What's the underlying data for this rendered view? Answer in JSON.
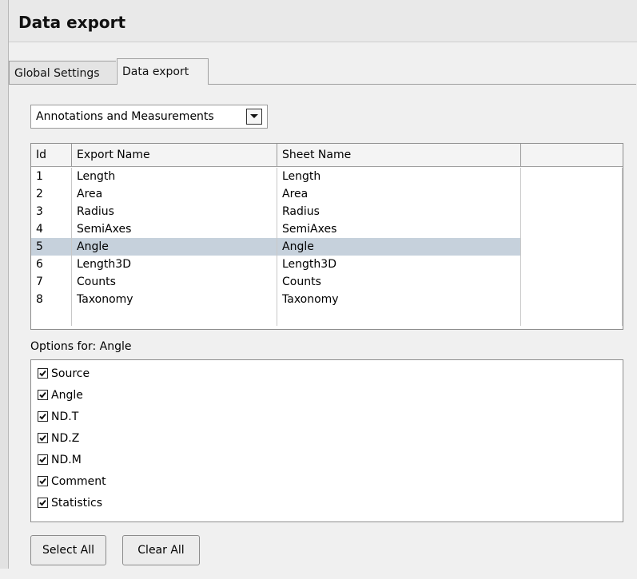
{
  "header": {
    "title": "Data export"
  },
  "tabs": [
    {
      "label": "Global Settings",
      "active": false
    },
    {
      "label": "Data export",
      "active": true
    }
  ],
  "dropdown": {
    "selected": "Annotations and Measurements"
  },
  "table": {
    "columns": [
      "Id",
      "Export Name",
      "Sheet Name"
    ],
    "rows": [
      {
        "id": "1",
        "export_name": "Length",
        "sheet_name": "Length"
      },
      {
        "id": "2",
        "export_name": "Area",
        "sheet_name": "Area"
      },
      {
        "id": "3",
        "export_name": "Radius",
        "sheet_name": "Radius"
      },
      {
        "id": "4",
        "export_name": "SemiAxes",
        "sheet_name": "SemiAxes"
      },
      {
        "id": "5",
        "export_name": "Angle",
        "sheet_name": "Angle"
      },
      {
        "id": "6",
        "export_name": "Length3D",
        "sheet_name": "Length3D"
      },
      {
        "id": "7",
        "export_name": "Counts",
        "sheet_name": "Counts"
      },
      {
        "id": "8",
        "export_name": "Taxonomy",
        "sheet_name": "Taxonomy"
      }
    ],
    "selected_row_index": 4
  },
  "options": {
    "label": "Options for: Angle",
    "items": [
      {
        "label": "Source",
        "checked": true
      },
      {
        "label": "Angle",
        "checked": true
      },
      {
        "label": "ND.T",
        "checked": true
      },
      {
        "label": "ND.Z",
        "checked": true
      },
      {
        "label": "ND.M",
        "checked": true
      },
      {
        "label": "Comment",
        "checked": true
      },
      {
        "label": "Statistics",
        "checked": true
      }
    ]
  },
  "buttons": {
    "select_all": "Select All",
    "clear_all": "Clear All"
  },
  "colors": {
    "selection": "#c6d1dc",
    "background": "#f0f0f0"
  },
  "icons": {
    "dropdown": "chevron-down-icon",
    "checkbox": "check-icon"
  }
}
